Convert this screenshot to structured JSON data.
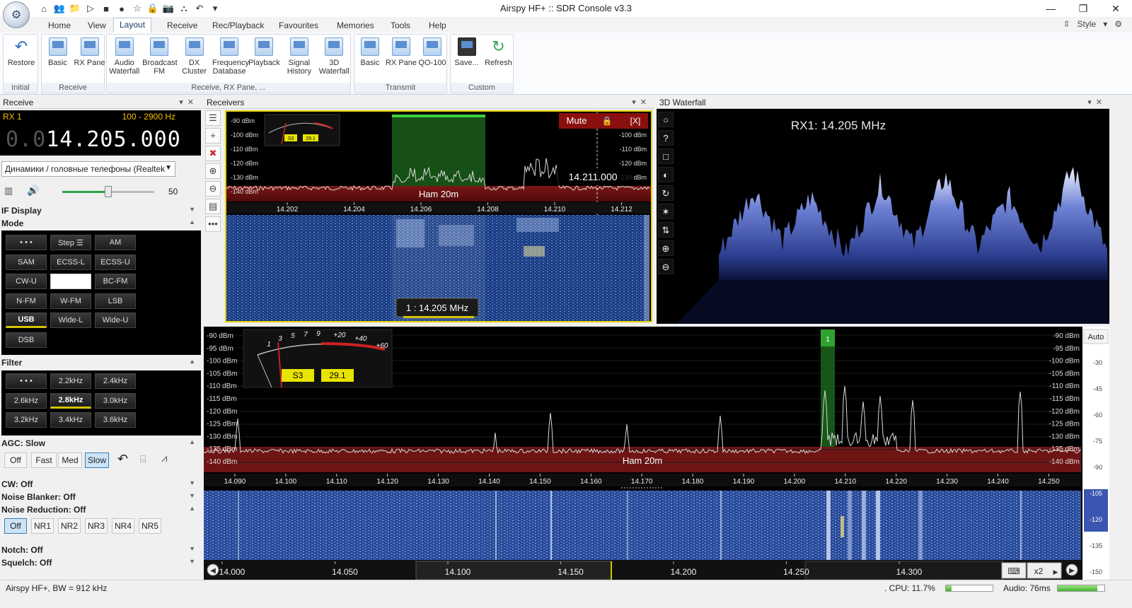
{
  "window": {
    "title": "Airspy HF+ :: SDR Console v3.3",
    "minimize": "—",
    "maximize": "❐",
    "close": "✕"
  },
  "qat_icons": [
    "⌂",
    "👥",
    "📁",
    "▷",
    "■",
    "●",
    "☆",
    "🔒",
    "📷",
    "⛬",
    "↶",
    "▾"
  ],
  "menu": {
    "tabs": [
      "Home",
      "View",
      "Layout",
      "Receive",
      "Rec/Playback",
      "Favourites",
      "Memories",
      "Tools",
      "Help"
    ],
    "active": "Layout",
    "style_label": "Style"
  },
  "ribbon": {
    "groups": [
      {
        "label": "Initial",
        "buttons": [
          "Restore"
        ]
      },
      {
        "label": "Receive",
        "buttons": [
          "Basic",
          "RX Pane"
        ]
      },
      {
        "label": "Receive, RX Pane, ...",
        "buttons": [
          "Audio Waterfall",
          "Broadcast FM",
          "DX Cluster",
          "Frequency Database",
          "Playback",
          "Signal History",
          "3D Waterfall"
        ]
      },
      {
        "label": "Transmit",
        "buttons": [
          "Basic",
          "RX Pane",
          "QO-100"
        ]
      },
      {
        "label": "Custom",
        "buttons": [
          "Save...",
          "Refresh"
        ]
      }
    ]
  },
  "receive_panel": {
    "title": "Receive",
    "rx_label": "RX 1",
    "bandwidth_range": "100 - 2900 Hz",
    "freq_dim": "0.0",
    "freq_main": "14.205.000",
    "audio_device": "Динамики / головные телефоны (Realtek",
    "volume": 50,
    "volume_label": "50",
    "if_display": "IF Display",
    "mode_title": "Mode",
    "modes": [
      "• • •",
      "Step ☰",
      "AM",
      "SAM",
      "ECSS-L",
      "ECSS-U",
      "CW-U",
      "",
      "BC-FM",
      "N-FM",
      "W-FM",
      "LSB",
      "USB",
      "Wide-L",
      "Wide-U",
      "DSB"
    ],
    "mode_selected": "USB",
    "filter_title": "Filter",
    "filters": [
      "• • •",
      "2.2kHz",
      "2.4kHz",
      "2.6kHz",
      "2.8kHz",
      "3.0kHz",
      "3.2kHz",
      "3.4kHz",
      "3.6kHz"
    ],
    "filter_selected": "2.8kHz",
    "agc_title": "AGC: Slow",
    "agc_buttons": [
      "Off",
      "Fast",
      "Med",
      "Slow"
    ],
    "agc_selected": "Slow",
    "cw": "CW: Off",
    "noise_blanker": "Noise Blanker: Off",
    "noise_reduction": "Noise Reduction: Off",
    "nr_buttons": [
      "Off",
      "NR1",
      "NR2",
      "NR3",
      "NR4",
      "NR5"
    ],
    "nr_selected": "Off",
    "notch": "Notch: Off",
    "squelch": "Squelch: Off"
  },
  "receivers_panel": {
    "title": "Receivers",
    "mute_label": "Mute",
    "close_label": "[X]",
    "db_labels": [
      "-90 dBm",
      "-100 dBm",
      "-110 dBm",
      "-120 dBm",
      "-130 dBm",
      "-140 dBm"
    ],
    "db_labels_right": [
      "-100 dBm",
      "-110 dBm",
      "-120 dBm",
      "-130 dBm"
    ],
    "freq_ticks": [
      "14.202",
      "14.204",
      "14.206",
      "14.208",
      "14.210",
      "14.212"
    ],
    "band_label": "Ham 20m",
    "cursor_freq": "14.211.000",
    "rx_tag": "1 : 14.205 MHz",
    "smeter_s": "S3",
    "smeter_val": "29.1"
  },
  "waterfall3d_panel": {
    "title": "3D Waterfall",
    "freq_label": "RX1:  14.205 MHz",
    "side_icons": [
      "○",
      "?",
      "□",
      "◐",
      "↻",
      "✶",
      "⇅",
      "⊕",
      "⊖"
    ]
  },
  "main_spectrum": {
    "db_labels_left": [
      "-90 dBm",
      "-95 dBm",
      "-100 dBm",
      "-105 dBm",
      "-110 dBm",
      "-115 dBm",
      "-120 dBm",
      "-125 dBm",
      "-130 dBm",
      "-135 dBm",
      "-140 dBm"
    ],
    "db_labels_right": [
      "-90 dBm",
      "-95 dBm",
      "-100 dBm",
      "-105 dBm",
      "-110 dBm",
      "-115 dBm",
      "-120 dBm",
      "-125 dBm",
      "-130 dBm",
      "-135 dBm",
      "-140 dBm"
    ],
    "freq_ticks": [
      "14.090",
      "14.100",
      "14.110",
      "14.120",
      "14.130",
      "14.140",
      "14.150",
      "14.160",
      "14.170",
      "14.180",
      "14.190",
      "14.200",
      "14.210",
      "14.220",
      "14.230",
      "14.240",
      "14.250"
    ],
    "band_label": "Ham 20m",
    "marker_label": "1",
    "auto_label": "Auto",
    "scale_labels": [
      "-30",
      "-45",
      "-60",
      "-75",
      "-90",
      "-105",
      "-120",
      "-135",
      "-150"
    ],
    "smeter_ticks": [
      "1",
      "3",
      "5",
      "7",
      "9",
      "+20",
      "+40",
      "+60"
    ],
    "smeter_s": "S3",
    "smeter_val": "29.1",
    "overview_ticks": [
      "14.000",
      "14.050",
      "14.100",
      "14.150",
      "14.200",
      "14.250",
      "14.300"
    ],
    "zoom_label": "x2"
  },
  "status_bar": {
    "left": "Airspy HF+, BW = 912 kHz",
    "cpu": ". CPU: 11.7%",
    "cpu_fraction": 0.117,
    "audio": "Audio: 76ms",
    "audio_fraction": 0.85
  }
}
